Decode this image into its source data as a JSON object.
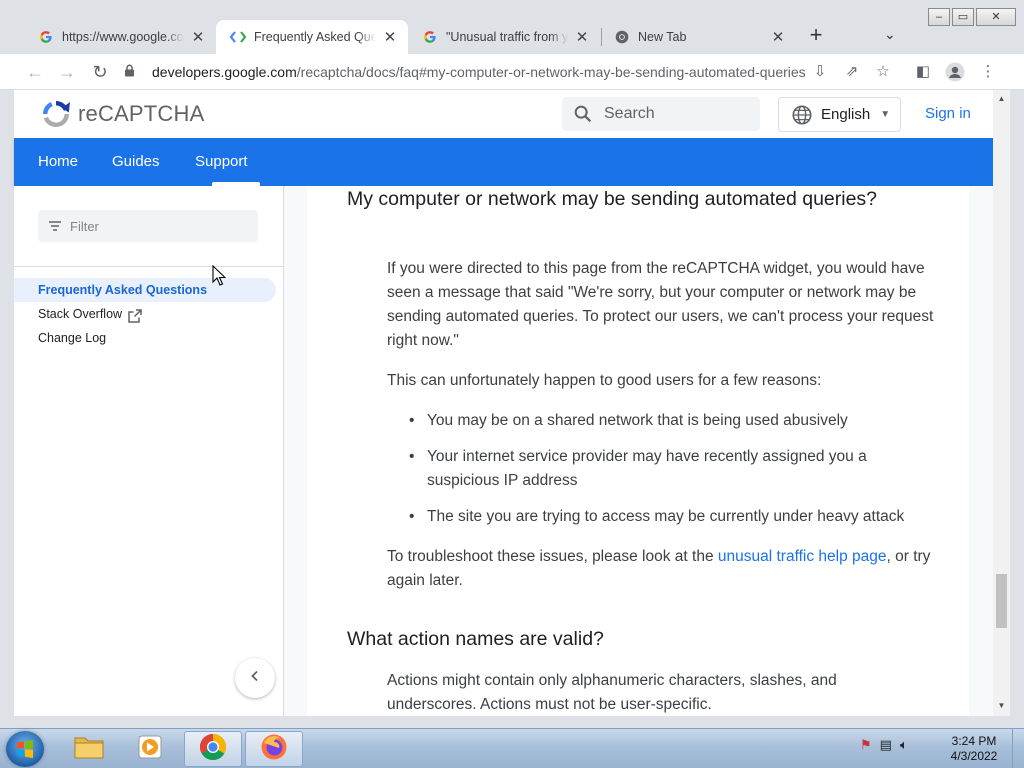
{
  "browser": {
    "tabs": [
      {
        "title": "https://www.google.com",
        "favicon": "google-g-icon",
        "active": false
      },
      {
        "title": "Frequently Asked Questions",
        "favicon": "developers-code-icon",
        "active": true
      },
      {
        "title": "\"Unusual traffic from your computer network\"",
        "favicon": "google-g-icon",
        "active": false
      },
      {
        "title": "New Tab",
        "favicon": "chrome-icon",
        "active": false
      }
    ],
    "url_host": "developers.google.com",
    "url_path": "/recaptcha/docs/faq#my-computer-or-network-may-be-sending-automated-queries"
  },
  "site": {
    "logo_text": "reCAPTCHA",
    "search_placeholder": "Search",
    "language": "English",
    "sign_in": "Sign in",
    "nav": [
      "Home",
      "Guides",
      "Support"
    ],
    "nav_active": "Support"
  },
  "sidebar": {
    "filter_placeholder": "Filter",
    "items": [
      {
        "label": "Frequently Asked Questions",
        "active": true
      },
      {
        "label": "Stack Overflow",
        "external": true
      },
      {
        "label": "Change Log"
      }
    ]
  },
  "article": {
    "heading1": "My computer or network may be sending automated queries?",
    "para1": "If you were directed to this page from the reCAPTCHA widget, you would have seen a message that said \"We're sorry, but your computer or network may be sending automated queries. To protect our users, we can't process your request right now.\"",
    "para2": "This can unfortunately happen to good users for a few reasons:",
    "bullets": [
      "You may be on a shared network that is being used abusively",
      "Your internet service provider may have recently assigned you a suspicious IP address",
      "The site you are trying to access may be currently under heavy attack"
    ],
    "para3_before": "To troubleshoot these issues, please look at the ",
    "para3_link": "unusual traffic help page",
    "para3_after": ", or try again later.",
    "heading2": "What action names are valid?",
    "para4": "Actions might contain only alphanumeric characters, slashes, and underscores. Actions must not be user-specific."
  },
  "taskbar": {
    "time": "3:24 PM",
    "date": "4/3/2022"
  },
  "colors": {
    "brand_blue": "#1a73e8",
    "active_item_bg": "#e8f0fe",
    "active_item_text": "#1967d2"
  }
}
